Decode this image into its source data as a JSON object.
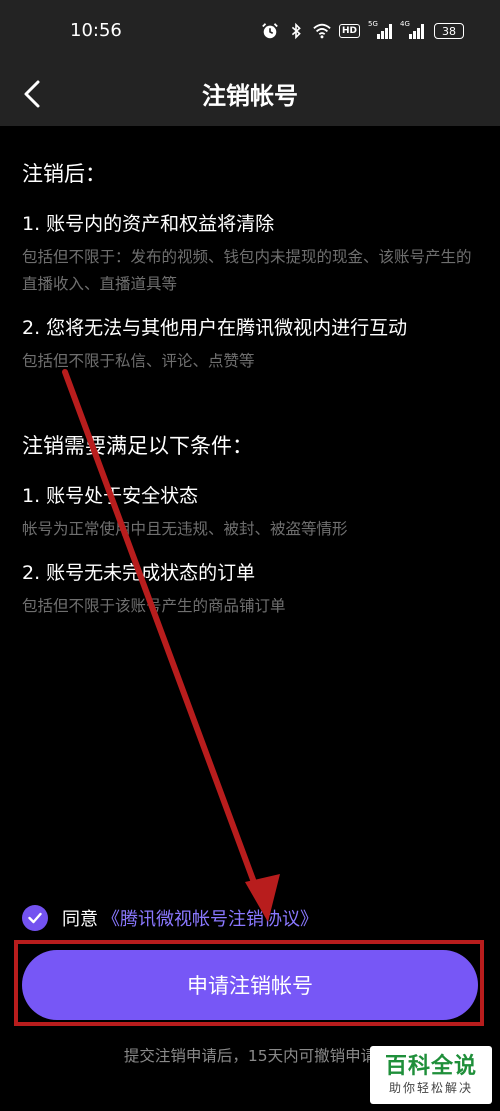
{
  "status_bar": {
    "time": "10:56",
    "network_badge": "HD",
    "signal1_label": "5G",
    "signal2_label": "4G",
    "battery": "38"
  },
  "nav": {
    "title": "注销帐号"
  },
  "after_section": {
    "title": "注销后：",
    "items": [
      {
        "title": "1. 账号内的资产和权益将清除",
        "desc": "包括但不限于：发布的视频、钱包内未提现的现金、该账号产生的直播收入、直播道具等"
      },
      {
        "title": "2. 您将无法与其他用户在腾讯微视内进行互动",
        "desc": "包括但不限于私信、评论、点赞等"
      }
    ]
  },
  "conditions_section": {
    "title": "注销需要满足以下条件：",
    "items": [
      {
        "title": "1. 账号处于安全状态",
        "desc": "帐号为正常使用中且无违规、被封、被盗等情形"
      },
      {
        "title": "2. 账号无未完成状态的订单",
        "desc": "包括但不限于该账号产生的商品铺订单"
      }
    ]
  },
  "agreement": {
    "checked": true,
    "prefix": "同意",
    "link": "《腾讯微视帐号注销协议》"
  },
  "submit_label": "申请注销帐号",
  "hint": "提交注销申请后，15天内可撤销申请",
  "watermark": {
    "title": "百科全说",
    "subtitle": "助你轻松解决"
  },
  "colors": {
    "accent": "#7757f6",
    "link": "#8a78ff",
    "annotation_red": "#b81d1d"
  }
}
